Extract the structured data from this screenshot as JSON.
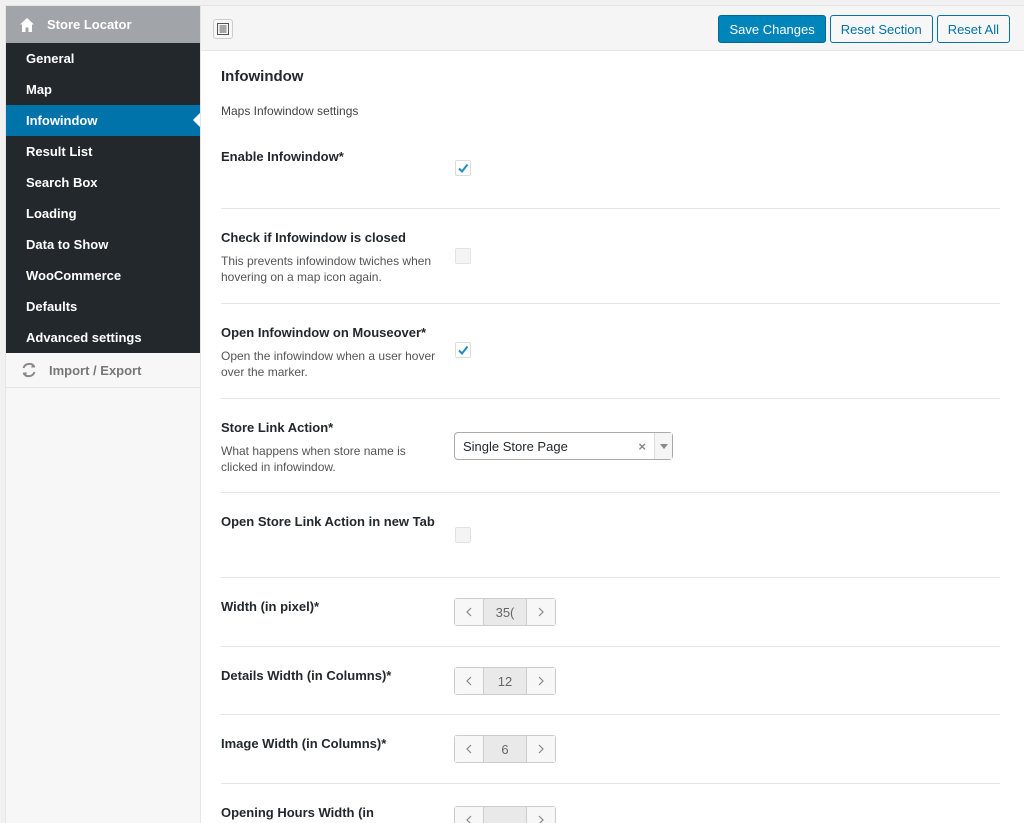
{
  "sidebar": {
    "header": {
      "label": "Store Locator",
      "icon": "home-icon"
    },
    "items": [
      {
        "label": "General"
      },
      {
        "label": "Map"
      },
      {
        "label": "Infowindow",
        "active": true
      },
      {
        "label": "Result List"
      },
      {
        "label": "Search Box"
      },
      {
        "label": "Loading"
      },
      {
        "label": "Data to Show"
      },
      {
        "label": "WooCommerce"
      },
      {
        "label": "Defaults"
      },
      {
        "label": "Advanced settings"
      }
    ],
    "import_export": {
      "label": "Import / Export",
      "icon": "refresh-icon"
    }
  },
  "toolbar": {
    "save_label": "Save Changes",
    "reset_section_label": "Reset Section",
    "reset_all_label": "Reset All"
  },
  "section": {
    "title": "Infowindow",
    "description": "Maps Infowindow settings"
  },
  "fields": {
    "enable": {
      "label": "Enable Infowindow*",
      "checked": true
    },
    "check_closed": {
      "label": "Check if Infowindow is closed",
      "desc": "This prevents infowindow twiches when hovering on a map icon again.",
      "checked": false
    },
    "mouseover": {
      "label": "Open Infowindow on Mouseover*",
      "desc": "Open the infowindow when a user hover over the marker.",
      "checked": true
    },
    "link_action": {
      "label": "Store Link Action*",
      "desc": "What happens when store name is clicked in infowindow.",
      "value": "Single Store Page",
      "clear": "×"
    },
    "new_tab": {
      "label": "Open Store Link Action in new Tab",
      "checked": false
    },
    "width": {
      "label": "Width (in pixel)*",
      "value": "35("
    },
    "details_width": {
      "label": "Details Width (in Columns)*",
      "value": "12"
    },
    "image_width": {
      "label": "Image Width (in Columns)*",
      "value": "6"
    },
    "opening_hours_width": {
      "label": "Opening Hours Width (in",
      "value": ""
    }
  },
  "colors": {
    "sidebar_bg": "#23282d",
    "active": "#0073aa",
    "primary_button": "#0085ba",
    "header_gray": "#a1a4a8"
  }
}
